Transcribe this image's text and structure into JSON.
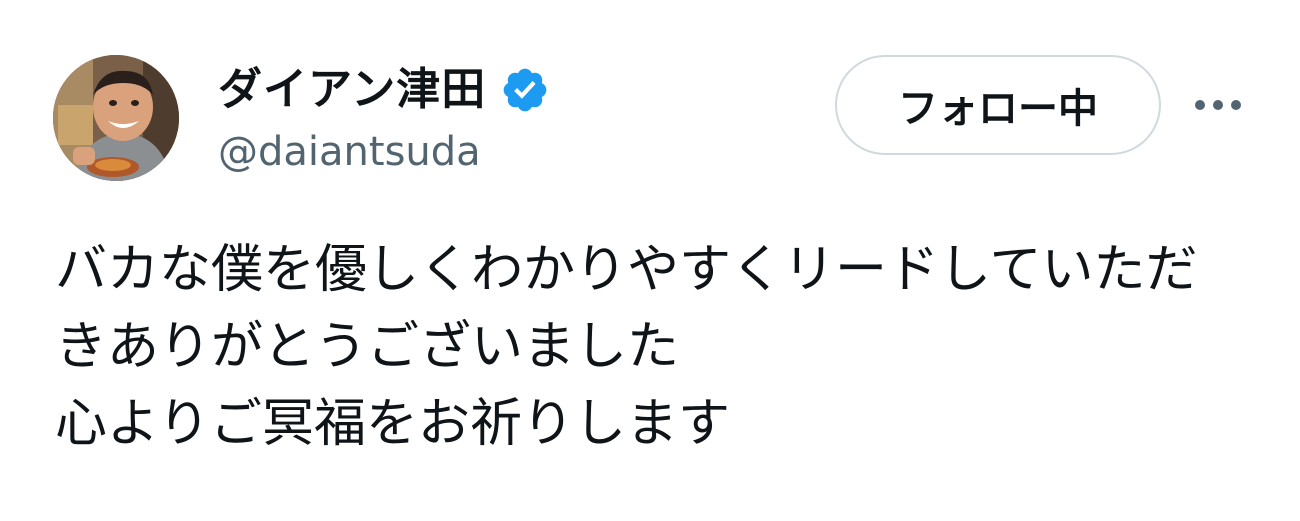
{
  "user": {
    "display_name": "ダイアン津田",
    "handle": "@daiantsuda",
    "avatar_icon": "profile-photo",
    "verified_icon": "verified-badge-icon",
    "verified_color": "#1d9bf0"
  },
  "actions": {
    "follow_label": "フォロー中",
    "more_icon": "more-options-icon"
  },
  "tweet": {
    "lines": [
      "バカな僕を優しくわかりやすくリードしていただ",
      "きありがとうございました",
      "心よりご冥福をお祈りします"
    ]
  },
  "colors": {
    "text": "#0f1419",
    "secondary_text": "#536471",
    "button_border": "#cfd9de",
    "background": "#ffffff"
  }
}
